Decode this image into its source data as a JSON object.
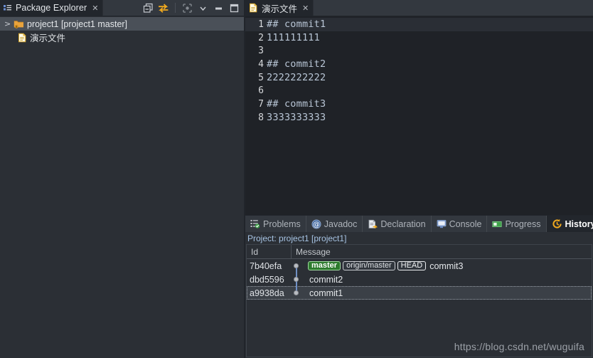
{
  "package_explorer": {
    "tab_label": "Package Explorer",
    "tab_close": "✕",
    "toolbar": [
      {
        "name": "collapse-all-icon",
        "title": "Collapse All"
      },
      {
        "name": "link-with-editor-icon",
        "title": "Link with Editor"
      },
      {
        "name": "focus-on-active-task-icon",
        "title": "Focus on Active Task"
      },
      {
        "name": "view-menu-chevron-down-icon",
        "title": "View Menu"
      },
      {
        "name": "minimize-icon",
        "title": "Minimize"
      },
      {
        "name": "maximize-icon",
        "title": "Maximize"
      }
    ],
    "tree": [
      {
        "arrow": ">",
        "label": "project1 [project1 master]",
        "icon": "git-project-folder-icon",
        "selected": true,
        "indent": false
      },
      {
        "arrow": "",
        "label": "演示文件",
        "icon": "file-icon",
        "selected": false,
        "indent": true
      }
    ]
  },
  "editor": {
    "tab_label": "演示文件",
    "tab_close": "✕",
    "tab_icon": "file-icon",
    "lines": [
      {
        "n": "1",
        "text": "## commit1",
        "current": true
      },
      {
        "n": "2",
        "text": "111111111",
        "current": false
      },
      {
        "n": "3",
        "text": "",
        "current": false
      },
      {
        "n": "4",
        "text": "## commit2",
        "current": false
      },
      {
        "n": "5",
        "text": "2222222222",
        "current": false
      },
      {
        "n": "6",
        "text": "",
        "current": false
      },
      {
        "n": "7",
        "text": "## commit3",
        "current": false
      },
      {
        "n": "8",
        "text": "3333333333",
        "current": false
      }
    ]
  },
  "bottom_view": {
    "tabs": [
      {
        "label": "Problems",
        "icon": "problems-icon",
        "active": false
      },
      {
        "label": "Javadoc",
        "icon": "javadoc-at-icon",
        "active": false
      },
      {
        "label": "Declaration",
        "icon": "declaration-icon",
        "active": false
      },
      {
        "label": "Console",
        "icon": "console-icon",
        "active": false
      },
      {
        "label": "Progress",
        "icon": "progress-icon",
        "active": false
      },
      {
        "label": "History",
        "icon": "history-icon",
        "active": true
      }
    ],
    "tab_close": "✕",
    "subheader": "Project: project1 [project1]",
    "table": {
      "columns": [
        "Id",
        "Message"
      ],
      "rows": [
        {
          "id": "7b40efa",
          "badges": [
            {
              "text": "master",
              "kind": "local"
            },
            {
              "text": "origin/master",
              "kind": "remote"
            },
            {
              "text": "HEAD",
              "kind": "head"
            }
          ],
          "message": "commit3",
          "selected": false
        },
        {
          "id": "dbd5596",
          "badges": [],
          "message": "commit2",
          "selected": false
        },
        {
          "id": "a9938da",
          "badges": [],
          "message": "commit1",
          "selected": true
        }
      ]
    }
  },
  "watermark": "https://blog.csdn.net/wuguifa",
  "colors": {
    "window_bg": "#2b2f35",
    "editor_bg": "#1f2227",
    "tab_active_bg": "#22262c",
    "accent_orange": "#f0a91e",
    "branch_green": "#2d7a2d",
    "graph_line": "#6f8fc4",
    "link_blue": "#a7c4e4"
  }
}
